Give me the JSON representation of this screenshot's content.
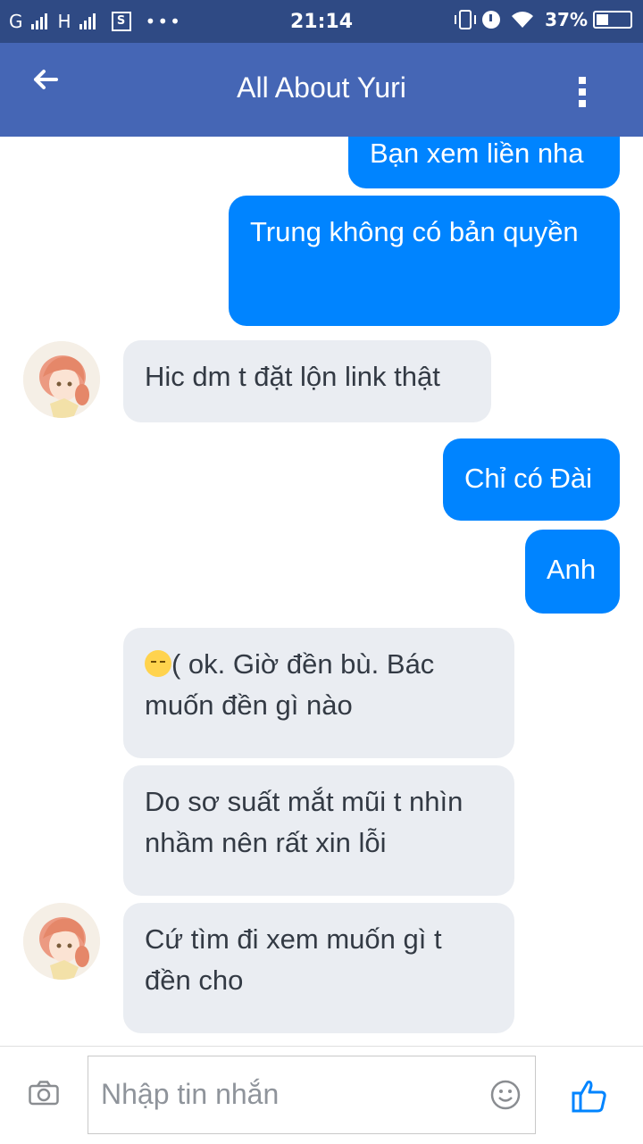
{
  "status_bar": {
    "network": "G",
    "network2": "H",
    "sim_icon": "S",
    "dots": "•••",
    "time": "21:14",
    "battery_percent": "37%",
    "battery_level": 0.37
  },
  "header": {
    "title": "All About Yuri",
    "back_icon": "arrow-left",
    "menu_icon": "more-vertical"
  },
  "messages": [
    {
      "direction": "outgoing",
      "text": "Bạn xem liền nha"
    },
    {
      "direction": "outgoing",
      "text": "Trung không có bản quyền"
    },
    {
      "direction": "incoming",
      "text": "Hic dm t đặt lộn link thật"
    },
    {
      "direction": "outgoing",
      "text": "Chỉ có Đài"
    },
    {
      "direction": "outgoing",
      "text": "Anh"
    },
    {
      "direction": "incoming",
      "text": "( ok. Giờ đền bù. Bác muốn đền gì nào",
      "emoji": "disappointed-face"
    },
    {
      "direction": "incoming",
      "text": "Do sơ suất mắt mũi t nhìn nhầm nên rất xin lỗi"
    },
    {
      "direction": "incoming",
      "text": "Cứ tìm đi xem muốn gì t đền cho"
    }
  ],
  "composer": {
    "placeholder": "Nhập tin nhắn",
    "camera_icon": "camera",
    "emoji_icon": "smiley",
    "send_icon": "thumbs-up"
  },
  "colors": {
    "app_bar": "#4566b5",
    "status_bar": "#2f4a84",
    "outgoing_bubble": "#0084ff",
    "incoming_bubble": "#eaedf2"
  }
}
